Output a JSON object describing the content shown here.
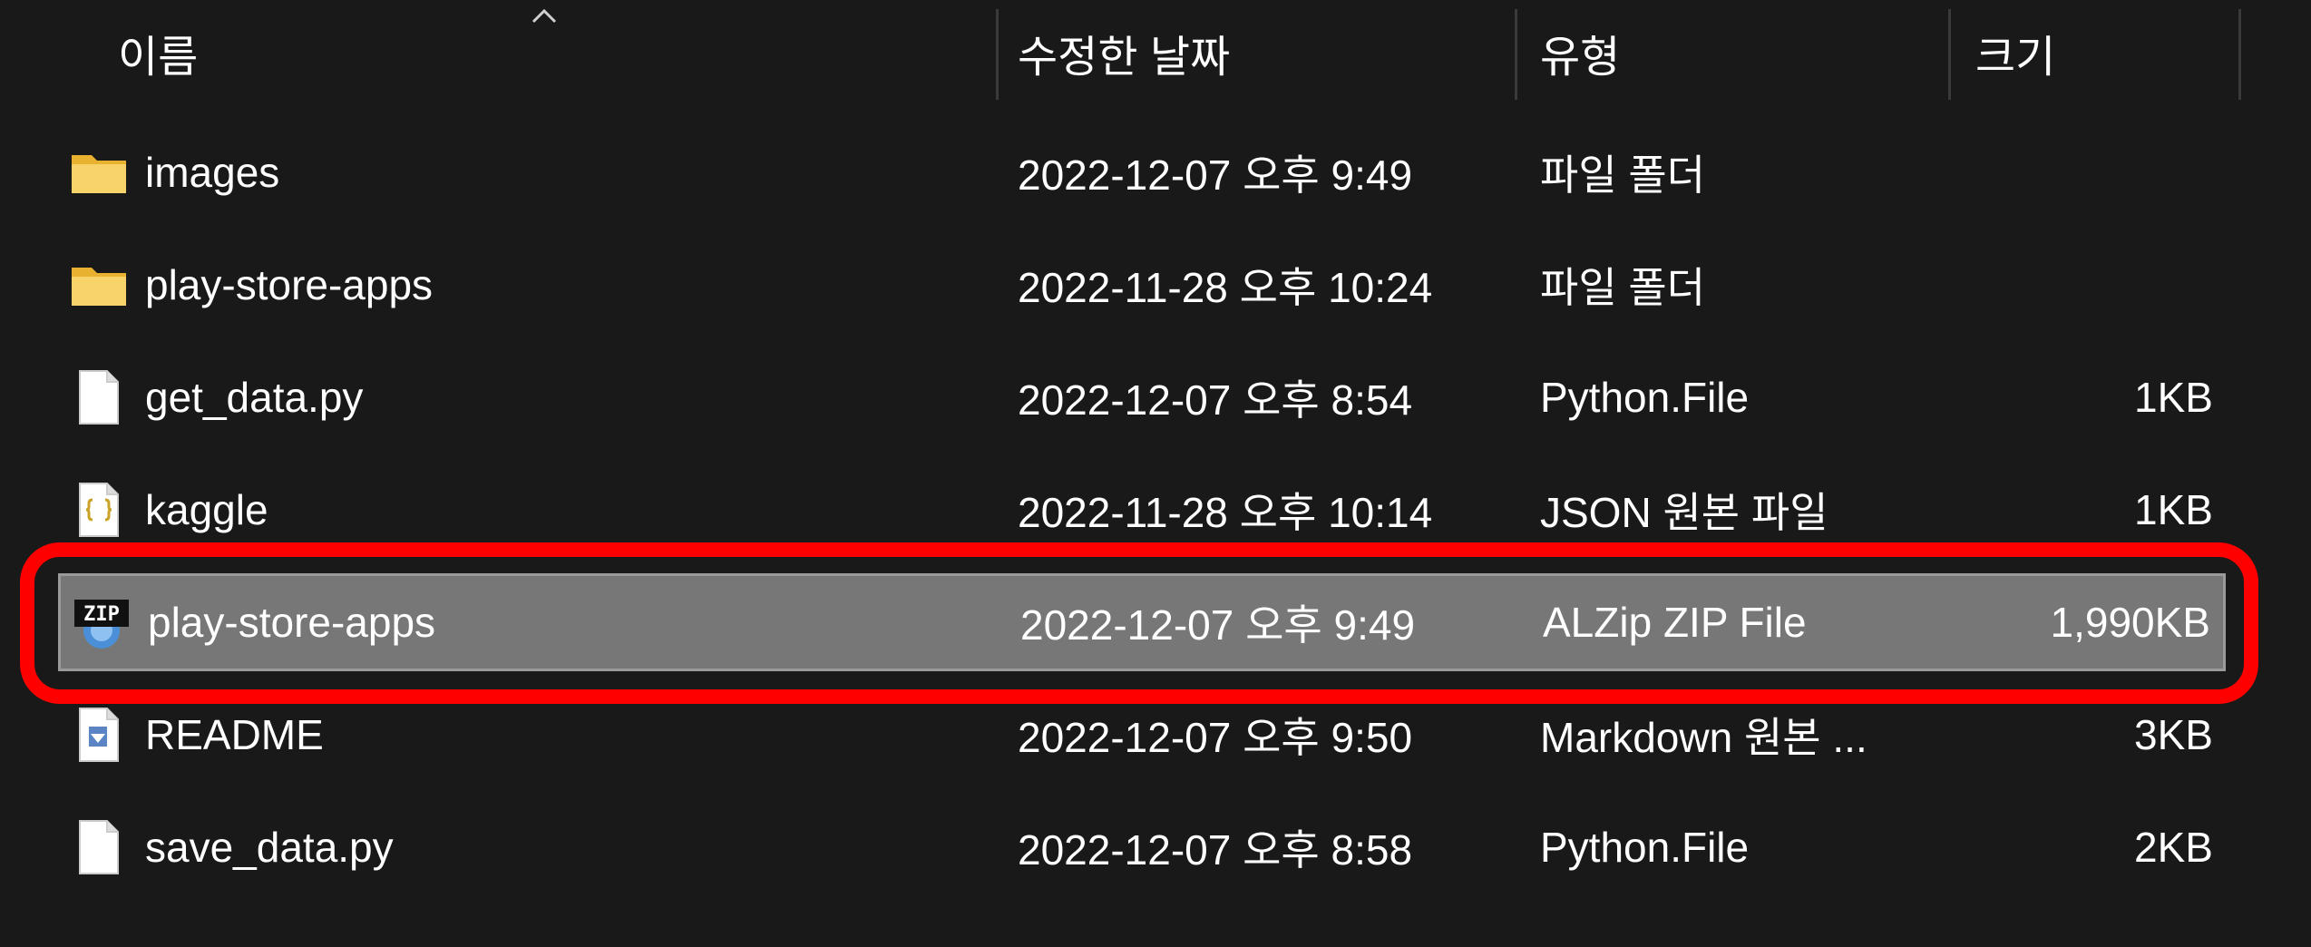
{
  "header": {
    "name_label": "이름",
    "date_label": "수정한 날짜",
    "type_label": "유형",
    "size_label": "크기",
    "sort_icon": "chevron-up-icon"
  },
  "files": [
    {
      "name": "images",
      "date": "2022-12-07 오후 9:49",
      "type": "파일 폴더",
      "size": "",
      "icon": "folder-icon"
    },
    {
      "name": "play-store-apps",
      "date": "2022-11-28 오후 10:24",
      "type": "파일 폴더",
      "size": "",
      "icon": "folder-icon"
    },
    {
      "name": "get_data.py",
      "date": "2022-12-07 오후 8:54",
      "type": "Python.File",
      "size": "1KB",
      "icon": "file-icon"
    },
    {
      "name": "kaggle",
      "date": "2022-11-28 오후 10:14",
      "type": "JSON 원본 파일",
      "size": "1KB",
      "icon": "json-file-icon"
    },
    {
      "name": "play-store-apps",
      "date": "2022-12-07 오후 9:49",
      "type": "ALZip ZIP File",
      "size": "1,990KB",
      "icon": "zip-file-icon",
      "selected": true
    },
    {
      "name": "README",
      "date": "2022-12-07 오후 9:50",
      "type": "Markdown 원본 ...",
      "size": "3KB",
      "icon": "markdown-file-icon"
    },
    {
      "name": "save_data.py",
      "date": "2022-12-07 오후 8:58",
      "type": "Python.File",
      "size": "2KB",
      "icon": "file-icon"
    }
  ],
  "colors": {
    "background": "#191919",
    "selected_row": "#777777",
    "highlight": "#ff0000",
    "folder": "#f5c542"
  },
  "zip_icon_text": "ZIP"
}
